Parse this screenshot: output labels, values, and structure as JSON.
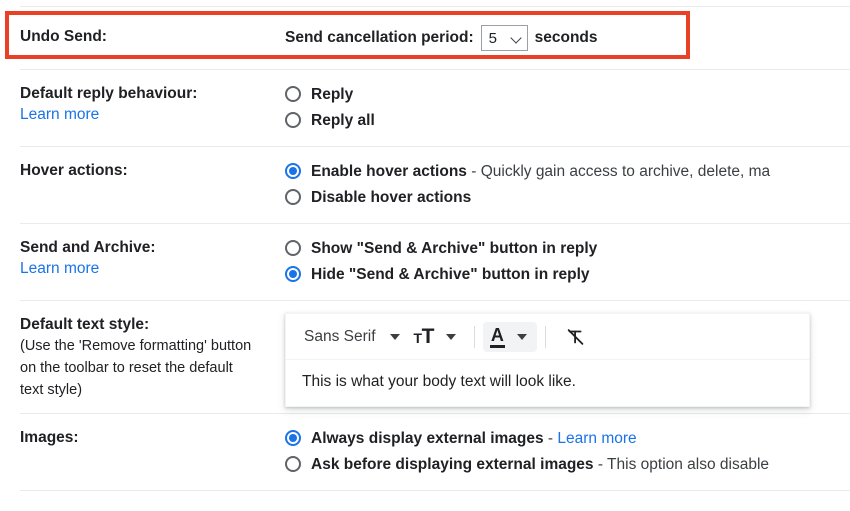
{
  "settings": {
    "undo_send": {
      "label": "Undo Send:",
      "field_label": "Send cancellation period:",
      "value": "5",
      "unit": "seconds",
      "highlight_color": "#ea4026"
    },
    "default_reply": {
      "label": "Default reply behaviour:",
      "learn_more": "Learn more",
      "options": [
        {
          "label": "Reply",
          "checked": false
        },
        {
          "label": "Reply all",
          "checked": false
        }
      ]
    },
    "hover_actions": {
      "label": "Hover actions:",
      "options": [
        {
          "label": "Enable hover actions",
          "desc": " - Quickly gain access to archive, delete, ma",
          "checked": true
        },
        {
          "label": "Disable hover actions",
          "desc": "",
          "checked": false
        }
      ]
    },
    "send_and_archive": {
      "label": "Send and Archive:",
      "learn_more": "Learn more",
      "options": [
        {
          "label": "Show \"Send & Archive\" button in reply",
          "checked": false
        },
        {
          "label": "Hide \"Send & Archive\" button in reply",
          "checked": true
        }
      ]
    },
    "default_text_style": {
      "label": "Default text style:",
      "note_line1": "(Use the 'Remove formatting' button",
      "note_line2": "on the toolbar to reset the default",
      "note_line3": "text style)",
      "toolbar": {
        "font_name": "Sans Serif",
        "size_small": "T",
        "size_large": "T",
        "color_letter": "A"
      },
      "preview_text": "This is what your body text will look like."
    },
    "images": {
      "label": "Images:",
      "options": [
        {
          "label": "Always display external images",
          "desc": " - ",
          "link": "Learn more",
          "checked": true
        },
        {
          "label": "Ask before displaying external images",
          "desc": " - This option also disable",
          "link": "",
          "checked": false
        }
      ]
    }
  },
  "link_color": "#1a73e8",
  "accent_color": "#1a73e8"
}
